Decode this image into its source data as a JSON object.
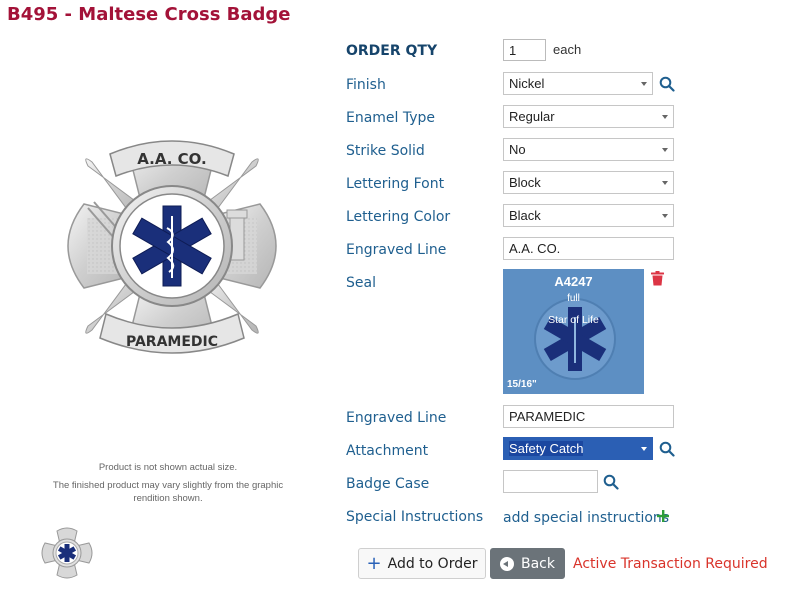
{
  "product": {
    "title": "B495 - Maltese Cross Badge",
    "badge_top_text": "A.A. CO.",
    "badge_bottom_text": "PARAMEDIC",
    "note_line1": "Product is not shown actual size.",
    "note_line2": "The finished product may vary slightly from the graphic rendition shown."
  },
  "form": {
    "order_qty": {
      "label": "ORDER QTY",
      "value": "1",
      "unit": "each"
    },
    "finish": {
      "label": "Finish",
      "value": "Nickel"
    },
    "enamel_type": {
      "label": "Enamel Type",
      "value": "Regular"
    },
    "strike_solid": {
      "label": "Strike Solid",
      "value": "No"
    },
    "lettering_font": {
      "label": "Lettering Font",
      "value": "Block"
    },
    "lettering_color": {
      "label": "Lettering Color",
      "value": "Black"
    },
    "engraved_line_1": {
      "label": "Engraved Line",
      "value": "A.A. CO."
    },
    "seal": {
      "label": "Seal",
      "code": "A4247",
      "type": "full",
      "name": "Star of Life",
      "size": "15/16\""
    },
    "engraved_line_2": {
      "label": "Engraved Line",
      "value": "PARAMEDIC"
    },
    "attachment": {
      "label": "Attachment",
      "value": "Safety Catch"
    },
    "badge_case": {
      "label": "Badge Case",
      "value": ""
    },
    "special_instructions": {
      "label": "Special Instructions",
      "link": "add special instructions"
    }
  },
  "actions": {
    "add_label": "Add to Order",
    "back_label": "Back",
    "warning": "Active Transaction Required"
  },
  "colors": {
    "title": "#a31238",
    "label": "#1f5f8f",
    "seal_bg": "#5d8fc3",
    "warning": "#d9342b",
    "star_blue": "#1a2f7a"
  },
  "icons": [
    "search-icon",
    "trash-icon",
    "plus-icon",
    "plus-icon-button",
    "back-arrow-icon"
  ]
}
